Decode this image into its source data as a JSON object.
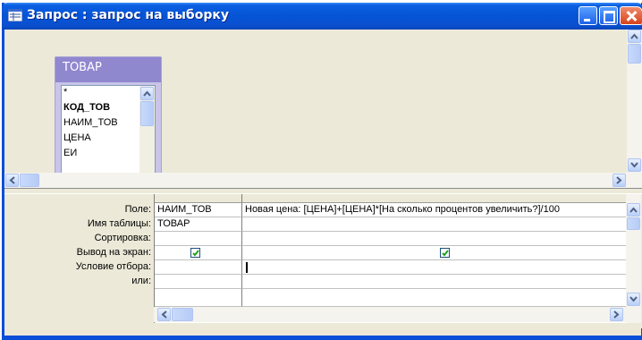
{
  "window": {
    "title": "Запрос : запрос на выборку"
  },
  "table_box": {
    "title": "ТОВАР",
    "fields": [
      "*",
      "КОД_ТОВ",
      "НАИМ_ТОВ",
      "ЦЕНА",
      "ЕИ"
    ]
  },
  "grid": {
    "row_labels": [
      "Поле:",
      "Имя таблицы:",
      "Сортировка:",
      "Вывод на экран:",
      "Условие отбора:",
      "или:"
    ],
    "columns": [
      {
        "field": "НАИМ_ТОВ",
        "table": "ТОВАР",
        "sort": "",
        "show": true,
        "criteria": "",
        "or": ""
      },
      {
        "field": "Новая цена: [ЦЕНА]+[ЦЕНА]*[На сколько процентов увеличить?]/100",
        "table": "",
        "sort": "",
        "show": true,
        "criteria": "",
        "or": ""
      }
    ]
  },
  "colors": {
    "titlebar": "#0654d6",
    "table_box": "#c9c4e8",
    "table_title": "#8f88cf"
  }
}
